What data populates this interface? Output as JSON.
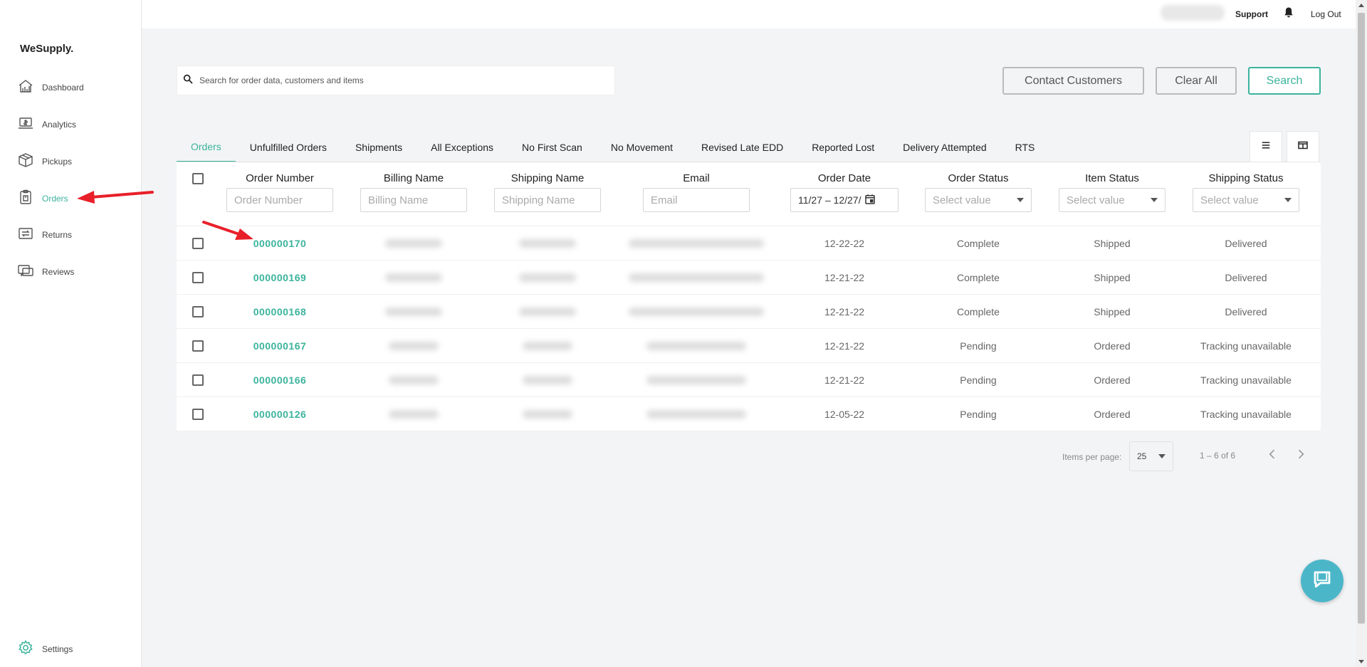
{
  "brand": "WeSupply.",
  "sidebar": {
    "items": [
      {
        "label": "Dashboard",
        "icon": "dashboard-icon"
      },
      {
        "label": "Analytics",
        "icon": "analytics-icon"
      },
      {
        "label": "Pickups",
        "icon": "box-icon"
      },
      {
        "label": "Orders",
        "icon": "clipboard-icon"
      },
      {
        "label": "Returns",
        "icon": "returns-icon"
      },
      {
        "label": "Reviews",
        "icon": "reviews-icon"
      }
    ],
    "settings_label": "Settings"
  },
  "topbar": {
    "support": "Support",
    "logout": "Log Out"
  },
  "search": {
    "placeholder": "Search for order data, customers and items"
  },
  "buttons": {
    "contact": "Contact Customers",
    "clear": "Clear All",
    "search": "Search"
  },
  "tabs": [
    "Orders",
    "Unfulfilled Orders",
    "Shipments",
    "All Exceptions",
    "No First Scan",
    "No Movement",
    "Revised Late EDD",
    "Reported Lost",
    "Delivery Attempted",
    "RTS"
  ],
  "table": {
    "headers": {
      "order_number": "Order Number",
      "billing_name": "Billing Name",
      "shipping_name": "Shipping Name",
      "email": "Email",
      "order_date": "Order Date",
      "order_status": "Order Status",
      "item_status": "Item Status",
      "shipping_status": "Shipping Status"
    },
    "filters": {
      "order_number_placeholder": "Order Number",
      "billing_name_placeholder": "Billing Name",
      "shipping_name_placeholder": "Shipping Name",
      "email_placeholder": "Email",
      "date_range": "11/27 – 12/27/",
      "select_placeholder": "Select value"
    },
    "rows": [
      {
        "order": "000000170",
        "date": "12-22-22",
        "order_status": "Complete",
        "item_status": "Shipped",
        "shipping_status": "Delivered"
      },
      {
        "order": "000000169",
        "date": "12-21-22",
        "order_status": "Complete",
        "item_status": "Shipped",
        "shipping_status": "Delivered"
      },
      {
        "order": "000000168",
        "date": "12-21-22",
        "order_status": "Complete",
        "item_status": "Shipped",
        "shipping_status": "Delivered"
      },
      {
        "order": "000000167",
        "date": "12-21-22",
        "order_status": "Pending",
        "item_status": "Ordered",
        "shipping_status": "Tracking unavailable"
      },
      {
        "order": "000000166",
        "date": "12-21-22",
        "order_status": "Pending",
        "item_status": "Ordered",
        "shipping_status": "Tracking unavailable"
      },
      {
        "order": "000000126",
        "date": "12-05-22",
        "order_status": "Pending",
        "item_status": "Ordered",
        "shipping_status": "Tracking unavailable"
      }
    ]
  },
  "paginator": {
    "label": "Items per page:",
    "page_size": "25",
    "range": "1 – 6 of 6"
  },
  "colors": {
    "accent": "#3bb39c",
    "chat": "#4cb6c9",
    "annotation_arrow": "#e8202a"
  }
}
